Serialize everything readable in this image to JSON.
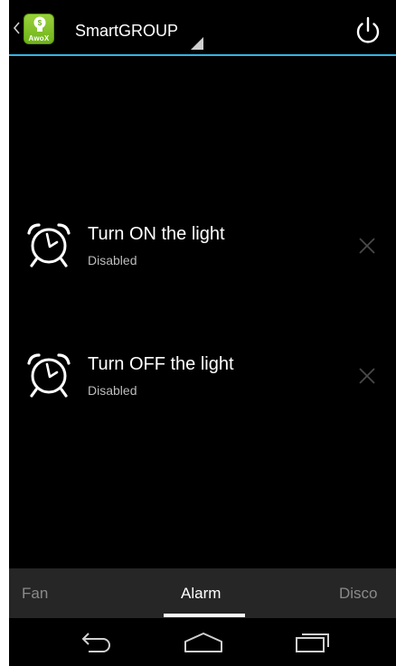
{
  "app": {
    "logo_text": "AwoX",
    "title": "SmartGROUP"
  },
  "alarms": [
    {
      "title": "Turn ON the light",
      "status": "Disabled"
    },
    {
      "title": "Turn OFF the light",
      "status": "Disabled"
    }
  ],
  "tabs": [
    {
      "label": "Fan",
      "selected": false
    },
    {
      "label": "Alarm",
      "selected": true
    },
    {
      "label": "Disco",
      "selected": false
    }
  ],
  "icons": {
    "back_caret": "chevron-left-icon",
    "power": "power-icon",
    "alarm": "alarm-clock-icon",
    "delete": "close-icon",
    "nav_back": "back-arrow-icon",
    "nav_home": "home-icon",
    "nav_recents": "recents-icon"
  },
  "colors": {
    "accent": "#33b5e5",
    "background": "#000000",
    "tab_bar": "#262626",
    "logo_green": "#8cc63f"
  }
}
